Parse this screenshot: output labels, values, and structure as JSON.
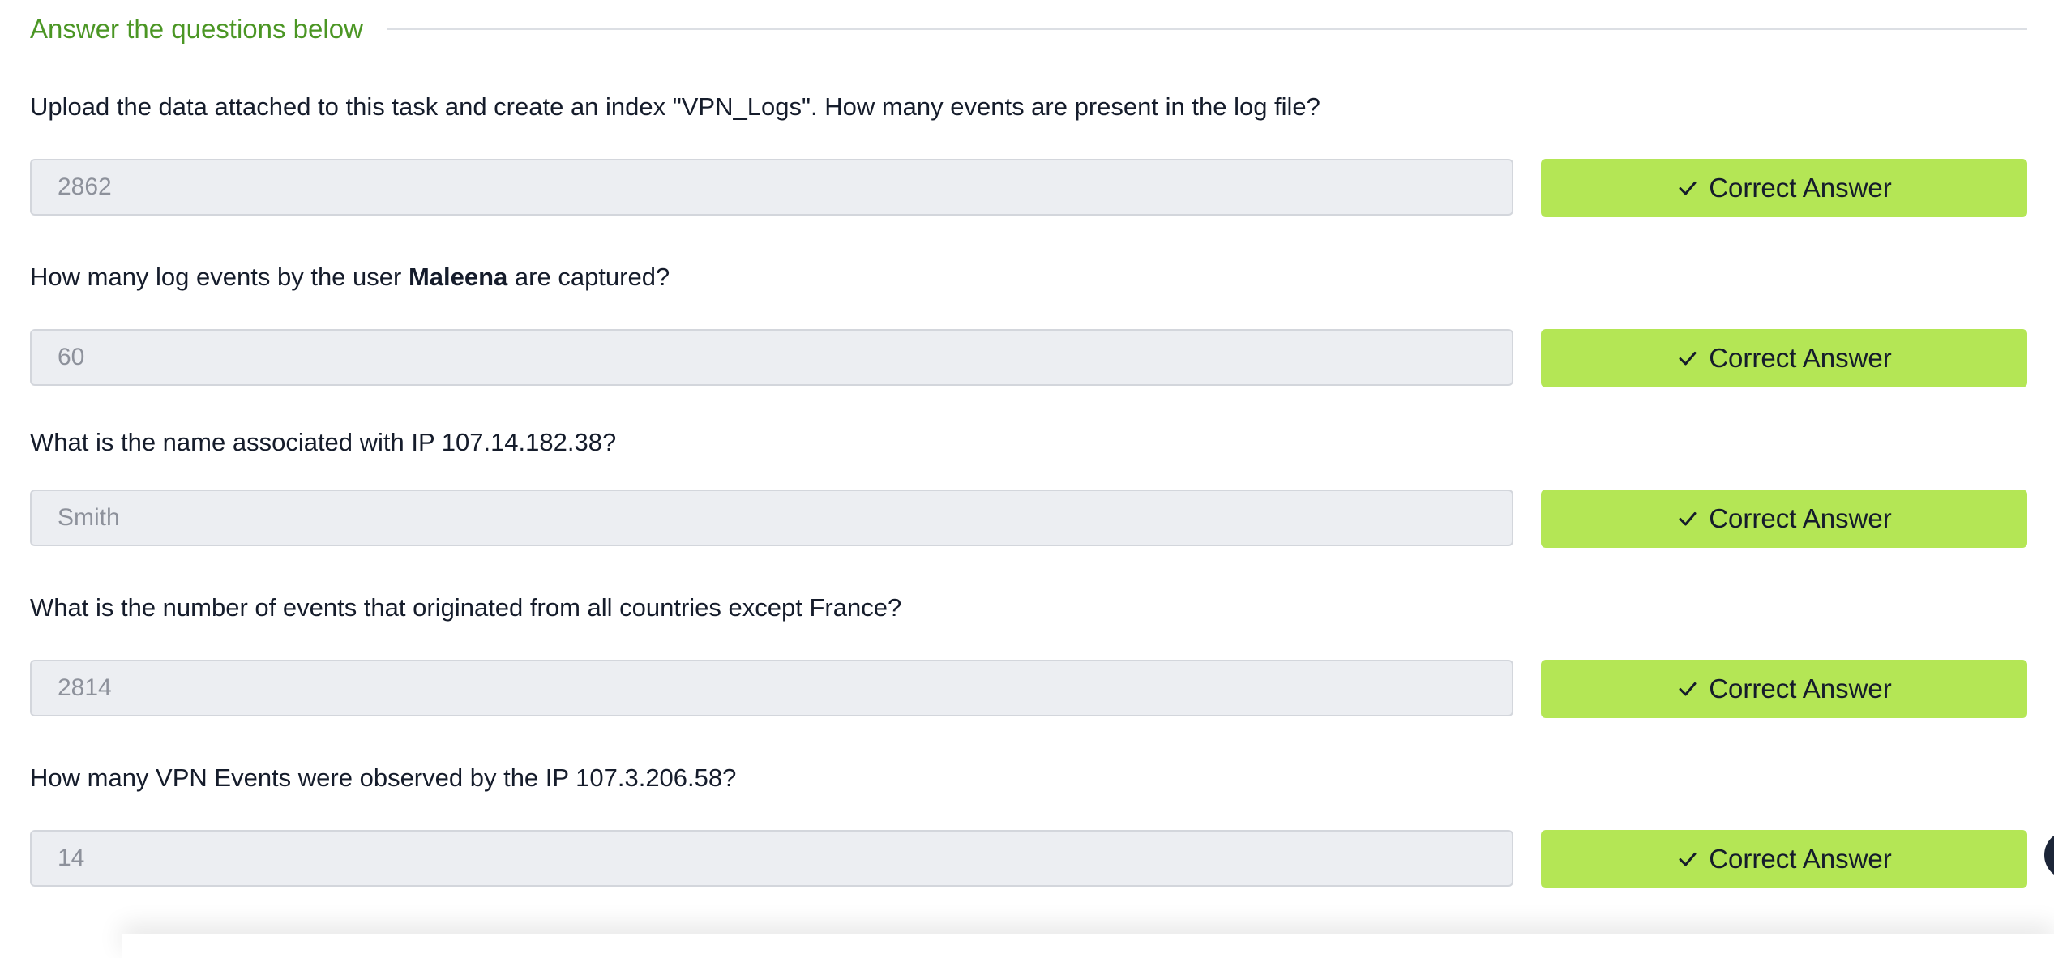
{
  "section": {
    "title": "Answer the questions below"
  },
  "questions": [
    {
      "text": "Upload the data attached to this task and create an index \"VPN_Logs\". How many events are present in the log file?",
      "answer": "2862",
      "button_label": "Correct Answer"
    },
    {
      "text_before": "How many log events by the user ",
      "text_bold": "Maleena",
      "text_after": " are captured?",
      "answer": "60",
      "button_label": "Correct Answer"
    },
    {
      "text": "What is the name associated with IP 107.14.182.38?",
      "answer": "Smith",
      "button_label": "Correct Answer"
    },
    {
      "text": "What is the number of events that originated from all countries except France?",
      "answer": "2814",
      "button_label": "Correct Answer"
    },
    {
      "text": "How many VPN Events were observed by the IP 107.3.206.58?",
      "answer": "14",
      "button_label": "Correct Answer"
    }
  ],
  "icons": {
    "button": "check-icon",
    "floating": "help-bubble-icon"
  },
  "colors": {
    "section_title": "#4b9624",
    "button_bg": "#b4e655",
    "input_bg": "#eceef2",
    "answer_text": "#8d919b",
    "question_text": "#151c2b"
  }
}
